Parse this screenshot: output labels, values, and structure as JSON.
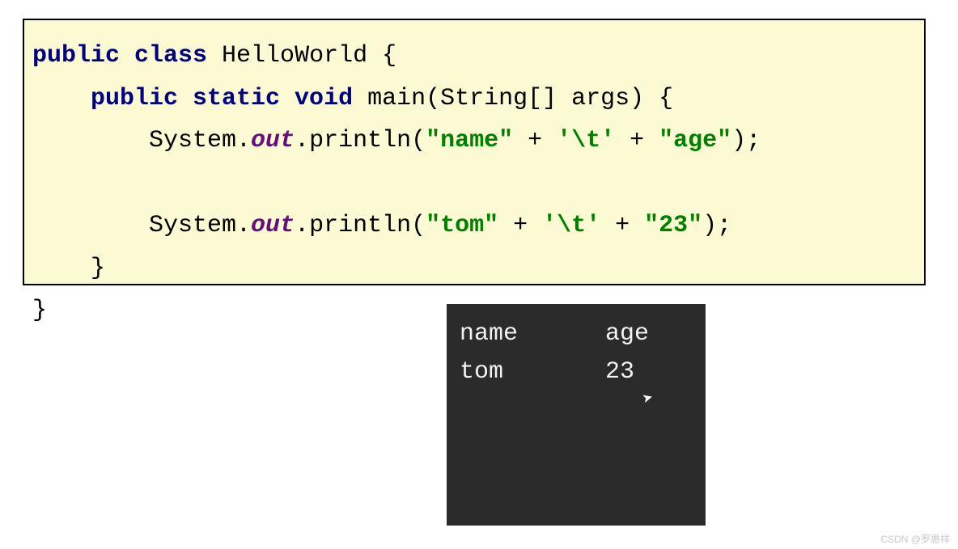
{
  "code": {
    "line1_kw1": "public class",
    "line1_cls": " HelloWorld {",
    "line2_indent": "    ",
    "line2_kw1": "public static void",
    "line2_rest": " main(String[] args) {",
    "line3_indent": "        System.",
    "line3_out": "out",
    "line3_mid": ".println(",
    "line3_str1": "\"name\"",
    "line3_plus1": " + ",
    "line3_str2": "'\\t'",
    "line3_plus2": " + ",
    "line3_str3": "\"age\"",
    "line3_end": ");",
    "line4_indent": "        System.",
    "line4_out": "out",
    "line4_mid": ".println(",
    "line4_str1": "\"tom\"",
    "line4_plus1": " + ",
    "line4_str2": "'\\t'",
    "line4_plus2": " + ",
    "line4_str3": "\"23\"",
    "line4_end": ");",
    "line5": "    }",
    "line6": "}"
  },
  "console": {
    "row1_col1": "name",
    "row1_col2": "age",
    "row2_col1": "tom",
    "row2_col2": "23"
  },
  "watermark": "CSDN @罗惠祥"
}
